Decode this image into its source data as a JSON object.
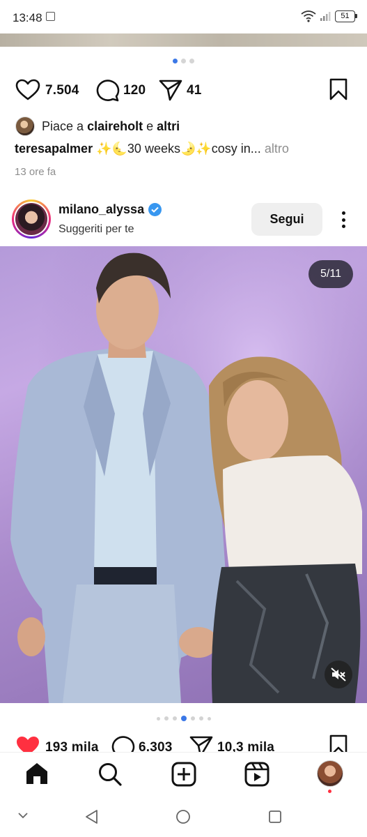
{
  "status_bar": {
    "time": "13:48",
    "battery": "51"
  },
  "prev_post": {
    "likes_count": "7.504",
    "comments_count": "120",
    "shares_count": "41",
    "liked_by_prefix": "Piace a",
    "liked_by_user": "claireholt",
    "liked_by_joiner": "e",
    "liked_by_others": "altri",
    "caption_user": "teresapalmer",
    "caption_text": "✨🌜30 weeks🌛✨cosy in...",
    "caption_more": "altro",
    "time_ago": "13 ore fa"
  },
  "post": {
    "username": "milano_alyssa",
    "subtitle": "Suggeriti per te",
    "follow_label": "Segui",
    "carousel_counter": "5/11",
    "likes_count": "193 mila",
    "comments_count": "6.303",
    "shares_count": "10,3 mila"
  },
  "colors": {
    "accent": "#3b78e7",
    "like_red": "#ff3040",
    "verified": "#3897f0"
  }
}
